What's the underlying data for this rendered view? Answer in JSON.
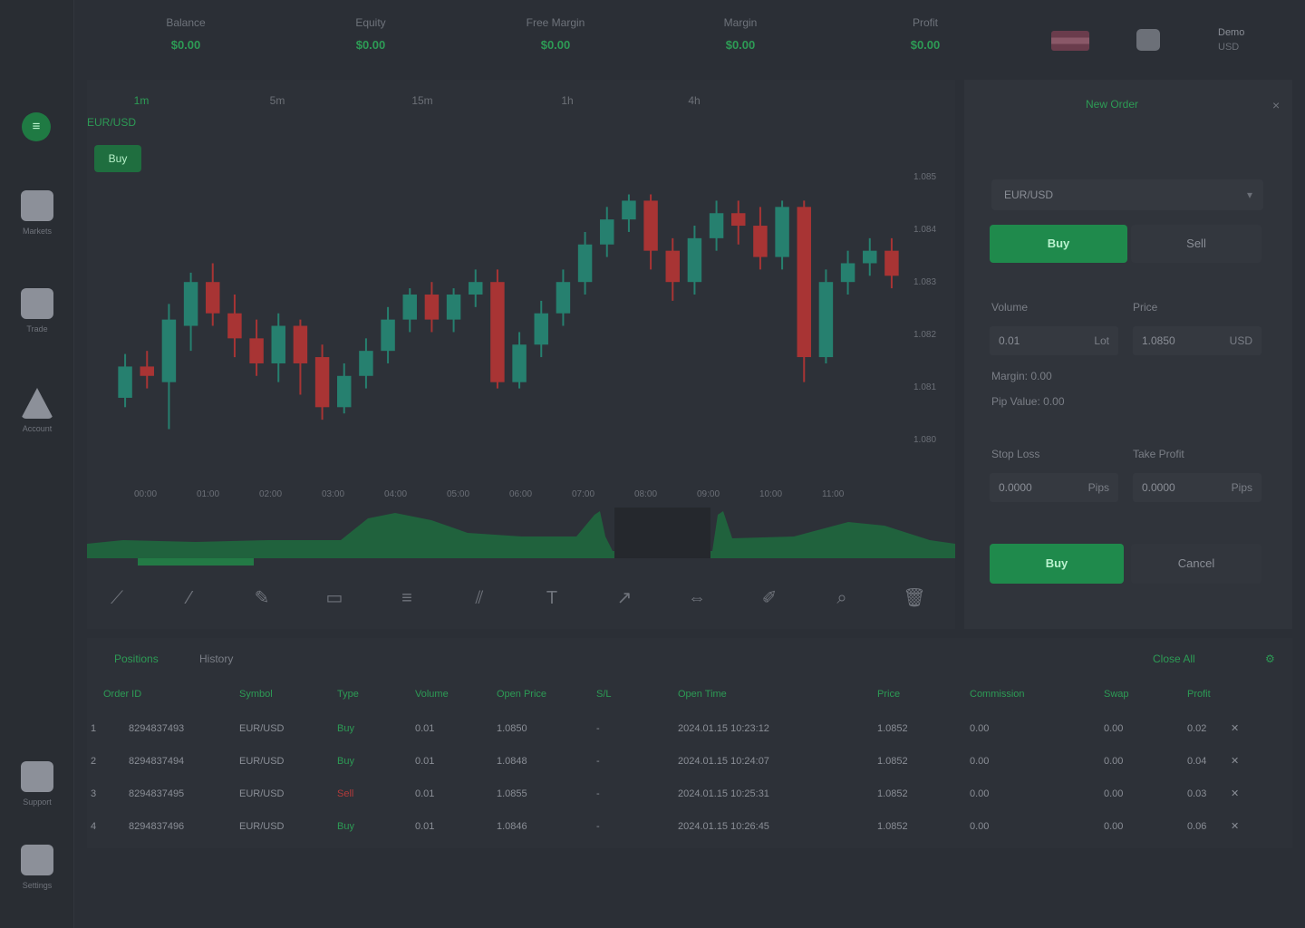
{
  "header": {
    "stats": [
      {
        "label": "Balance",
        "value": "$0.00"
      },
      {
        "label": "Equity",
        "value": "$0.00"
      },
      {
        "label": "Free Margin",
        "value": "$0.00"
      },
      {
        "label": "Margin",
        "value": "$0.00"
      },
      {
        "label": "Profit",
        "value": "$0.00"
      }
    ],
    "account": {
      "name": "Demo",
      "sub": "USD"
    }
  },
  "sidebar": {
    "logo": "≡",
    "items": [
      {
        "label": "Markets",
        "icon": "markets-icon"
      },
      {
        "label": "Trade",
        "icon": "trade-icon"
      },
      {
        "label": "Account",
        "icon": "account-icon"
      },
      {
        "label": "Support",
        "icon": "support-icon"
      },
      {
        "label": "Settings",
        "icon": "settings-icon"
      }
    ]
  },
  "chart": {
    "timeframes": [
      "1m",
      "5m",
      "15m",
      "1h",
      "4h"
    ],
    "active_timeframe": "1m",
    "symbol": "EUR/USD",
    "symbol_badge": "Buy",
    "x_labels": [
      "00:00",
      "01:00",
      "02:00",
      "03:00",
      "04:00",
      "05:00",
      "06:00",
      "07:00",
      "08:00",
      "09:00",
      "10:00",
      "11:00"
    ],
    "y_labels": [
      "1.085",
      "1.084",
      "1.083",
      "1.082",
      "1.081",
      "1.080"
    ],
    "tools": [
      "trend-line-icon",
      "ray-icon",
      "pencil-icon",
      "rectangle-icon",
      "fib-icon",
      "channel-icon",
      "text-icon",
      "arrow-icon",
      "measure-icon",
      "brush-icon",
      "zoom-icon",
      "trash-icon"
    ],
    "colors": {
      "up": "#26806f",
      "down": "#a83434",
      "volume": "#1f6b3e"
    }
  },
  "chart_data": {
    "type": "candlestick",
    "candles": [
      {
        "o": 1.0815,
        "c": 1.0825,
        "h": 1.0829,
        "l": 1.0812
      },
      {
        "o": 1.0825,
        "c": 1.0822,
        "h": 1.083,
        "l": 1.0818
      },
      {
        "o": 1.082,
        "c": 1.084,
        "h": 1.0845,
        "l": 1.0805
      },
      {
        "o": 1.0838,
        "c": 1.0852,
        "h": 1.0855,
        "l": 1.083
      },
      {
        "o": 1.0852,
        "c": 1.0842,
        "h": 1.0858,
        "l": 1.0838
      },
      {
        "o": 1.0842,
        "c": 1.0834,
        "h": 1.0848,
        "l": 1.0828
      },
      {
        "o": 1.0834,
        "c": 1.0826,
        "h": 1.084,
        "l": 1.0822
      },
      {
        "o": 1.0826,
        "c": 1.0838,
        "h": 1.0842,
        "l": 1.082
      },
      {
        "o": 1.0838,
        "c": 1.0826,
        "h": 1.084,
        "l": 1.0816
      },
      {
        "o": 1.0828,
        "c": 1.0812,
        "h": 1.0832,
        "l": 1.0808
      },
      {
        "o": 1.0812,
        "c": 1.0822,
        "h": 1.0826,
        "l": 1.081
      },
      {
        "o": 1.0822,
        "c": 1.083,
        "h": 1.0834,
        "l": 1.0818
      },
      {
        "o": 1.083,
        "c": 1.084,
        "h": 1.0844,
        "l": 1.0826
      },
      {
        "o": 1.084,
        "c": 1.0848,
        "h": 1.085,
        "l": 1.0836
      },
      {
        "o": 1.0848,
        "c": 1.084,
        "h": 1.0852,
        "l": 1.0836
      },
      {
        "o": 1.084,
        "c": 1.0848,
        "h": 1.085,
        "l": 1.0836
      },
      {
        "o": 1.0848,
        "c": 1.0852,
        "h": 1.0856,
        "l": 1.0844
      },
      {
        "o": 1.0852,
        "c": 1.082,
        "h": 1.0856,
        "l": 1.0818
      },
      {
        "o": 1.082,
        "c": 1.0832,
        "h": 1.0836,
        "l": 1.0818
      },
      {
        "o": 1.0832,
        "c": 1.0842,
        "h": 1.0846,
        "l": 1.0828
      },
      {
        "o": 1.0842,
        "c": 1.0852,
        "h": 1.0856,
        "l": 1.0838
      },
      {
        "o": 1.0852,
        "c": 1.0864,
        "h": 1.0868,
        "l": 1.0848
      },
      {
        "o": 1.0864,
        "c": 1.0872,
        "h": 1.0876,
        "l": 1.086
      },
      {
        "o": 1.0872,
        "c": 1.0878,
        "h": 1.088,
        "l": 1.0868
      },
      {
        "o": 1.0878,
        "c": 1.0862,
        "h": 1.088,
        "l": 1.0856
      },
      {
        "o": 1.0862,
        "c": 1.0852,
        "h": 1.0866,
        "l": 1.0846
      },
      {
        "o": 1.0852,
        "c": 1.0866,
        "h": 1.087,
        "l": 1.0848
      },
      {
        "o": 1.0866,
        "c": 1.0874,
        "h": 1.0878,
        "l": 1.0862
      },
      {
        "o": 1.0874,
        "c": 1.087,
        "h": 1.0878,
        "l": 1.0864
      },
      {
        "o": 1.087,
        "c": 1.086,
        "h": 1.0876,
        "l": 1.0856
      },
      {
        "o": 1.086,
        "c": 1.0876,
        "h": 1.0878,
        "l": 1.0856
      },
      {
        "o": 1.0876,
        "c": 1.0828,
        "h": 1.0878,
        "l": 1.082
      },
      {
        "o": 1.0828,
        "c": 1.0852,
        "h": 1.0856,
        "l": 1.0826
      },
      {
        "o": 1.0852,
        "c": 1.0858,
        "h": 1.0862,
        "l": 1.0848
      },
      {
        "o": 1.0858,
        "c": 1.0862,
        "h": 1.0866,
        "l": 1.0854
      },
      {
        "o": 1.0862,
        "c": 1.0854,
        "h": 1.0866,
        "l": 1.085
      }
    ],
    "ylim": [
      1.0795,
      1.089
    ]
  },
  "order": {
    "tab_active": "New Order",
    "symbol_select": "EUR/USD",
    "buy_label": "Buy",
    "sell_label": "Sell",
    "volume_label": "Volume",
    "volume_value": "0.01",
    "volume_unit": "Lot",
    "price_label": "Price",
    "price_value": "1.0850",
    "price_unit": "USD",
    "margin_line": "Margin: 0.00",
    "pip_line": "Pip Value: 0.00",
    "sl_label": "Stop Loss",
    "sl_value": "0.0000",
    "sl_unit": "Pips",
    "tp_label": "Take Profit",
    "tp_value": "0.0000",
    "tp_unit": "Pips",
    "place_label": "Buy",
    "cancel_label": "Cancel"
  },
  "positions": {
    "tabs": [
      "Positions",
      "History"
    ],
    "right_link": "Close All",
    "columns": [
      "Order ID",
      "Symbol",
      "Type",
      "Volume",
      "Open Price",
      "S/L",
      "Open Time",
      "Price",
      "Commission",
      "Swap",
      "Profit"
    ],
    "rows": [
      {
        "id": "1",
        "order": "8294837493",
        "symbol": "EUR/USD",
        "type": "Buy",
        "dir": "up",
        "volume": "0.01",
        "open": "1.0850",
        "sl": "-",
        "time": "2024.01.15 10:23:12",
        "price": "1.0852",
        "commission": "0.00",
        "swap": "0.00",
        "profit": "0.02"
      },
      {
        "id": "2",
        "order": "8294837494",
        "symbol": "EUR/USD",
        "type": "Buy",
        "dir": "up",
        "volume": "0.01",
        "open": "1.0848",
        "sl": "-",
        "time": "2024.01.15 10:24:07",
        "price": "1.0852",
        "commission": "0.00",
        "swap": "0.00",
        "profit": "0.04"
      },
      {
        "id": "3",
        "order": "8294837495",
        "symbol": "EUR/USD",
        "type": "Sell",
        "dir": "down",
        "volume": "0.01",
        "open": "1.0855",
        "sl": "-",
        "time": "2024.01.15 10:25:31",
        "price": "1.0852",
        "commission": "0.00",
        "swap": "0.00",
        "profit": "0.03"
      },
      {
        "id": "4",
        "order": "8294837496",
        "symbol": "EUR/USD",
        "type": "Buy",
        "dir": "up",
        "volume": "0.01",
        "open": "1.0846",
        "sl": "-",
        "time": "2024.01.15 10:26:45",
        "price": "1.0852",
        "commission": "0.00",
        "swap": "0.00",
        "profit": "0.06"
      }
    ]
  }
}
